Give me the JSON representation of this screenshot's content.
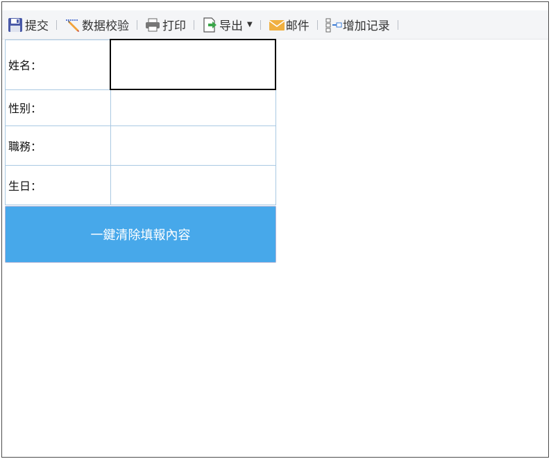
{
  "toolbar": {
    "submit": "提交",
    "validate": "数据校验",
    "print": "打印",
    "export": "导出",
    "mail": "邮件",
    "add_record": "增加记录"
  },
  "form": {
    "name_label": "姓名：",
    "gender_label": "性别：",
    "job_label": "職務：",
    "birth_label": "生日：",
    "name_value": "",
    "gender_value": "",
    "job_value": "",
    "birth_value": ""
  },
  "clear_button": "一鍵清除填報內容",
  "colors": {
    "button": "#47a8ea",
    "table_border": "#a9c8e2"
  }
}
